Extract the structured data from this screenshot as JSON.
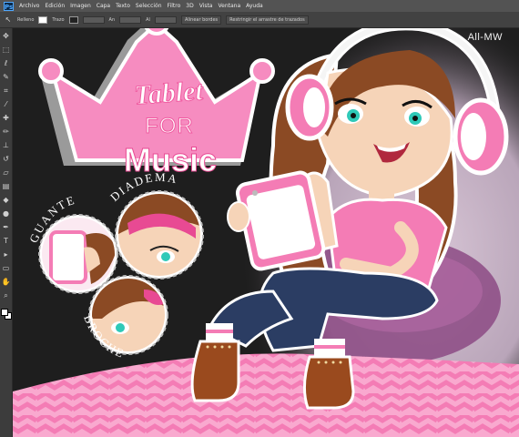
{
  "app": {
    "logo_text": "Ps",
    "menu": [
      "Archivo",
      "Edición",
      "Imagen",
      "Capa",
      "Texto",
      "Selección",
      "Filtro",
      "3D",
      "Vista",
      "Ventana",
      "Ayuda"
    ]
  },
  "options_bar": {
    "fill_label": "Relleno",
    "stroke_label": "Trazo",
    "width_label": "An",
    "height_label": "Al",
    "align_edges_label": "Alinear bordes",
    "constrain_label": "Restringir el arrastre de trazados"
  },
  "watermark": "All-MW",
  "title": {
    "line1": "Tablet",
    "line2": "FOR",
    "line3": "Music"
  },
  "labels": {
    "glove": "GUANTE",
    "headband": "DIADEMA",
    "brooch": "BROCHE"
  },
  "tools": [
    "move",
    "marquee",
    "lasso",
    "quick-select",
    "crop",
    "eyedropper",
    "healing",
    "brush",
    "stamp",
    "history-brush",
    "eraser",
    "gradient",
    "blur",
    "dodge",
    "pen",
    "type",
    "path-select",
    "shape",
    "hand",
    "zoom"
  ],
  "colors": {
    "accent_pink": "#f47cb5",
    "hot_pink": "#e84a93",
    "light_pink": "#f9b6d6",
    "crown_pink": "#f68cc0",
    "hair_brown": "#8b4a24",
    "jeans_blue": "#2b3d63",
    "boot_brown": "#9a4a1e",
    "skin": "#f6d4b8",
    "eye_teal": "#2fc9b8",
    "canvas_dark": "#1e1e1e"
  }
}
